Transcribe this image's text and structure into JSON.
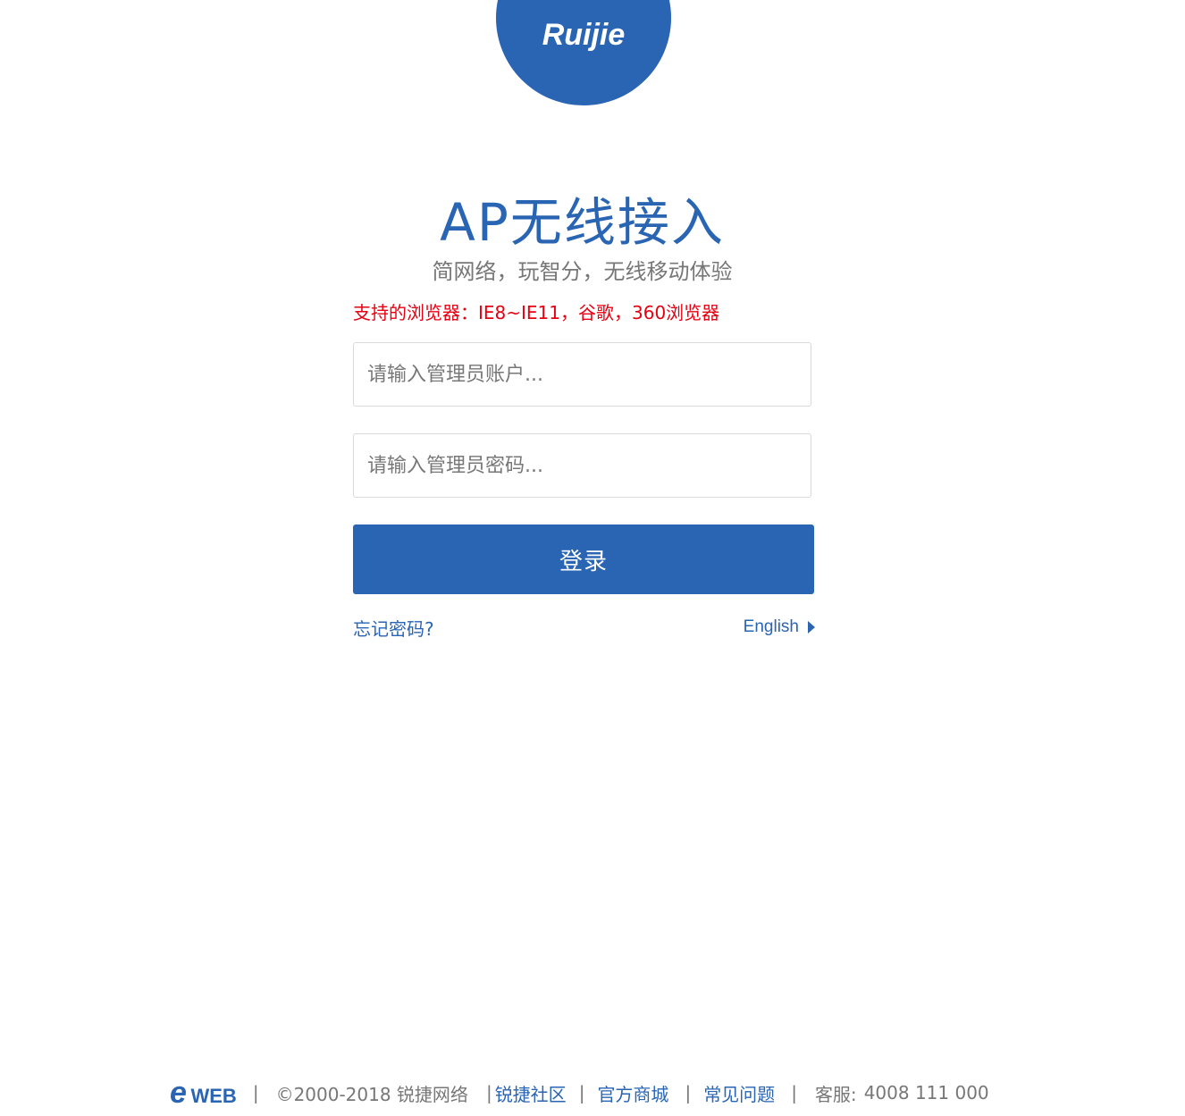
{
  "brand": {
    "logo_text": "Ruijie",
    "primary_color": "#2a65b3",
    "warning_color": "#e60012"
  },
  "header": {
    "title": "AP无线接入",
    "subtitle": "简网络，玩智分，无线移动体验"
  },
  "notice": {
    "browser_support": "支持的浏览器：IE8~IE11，谷歌，360浏览器"
  },
  "form": {
    "username_placeholder": "请输入管理员账户...",
    "username_value": "",
    "password_placeholder": "请输入管理员密码...",
    "password_value": "",
    "login_label": "登录",
    "forgot_label": "忘记密码?",
    "language_label": "English"
  },
  "footer": {
    "logo_e": "e",
    "logo_web": "WEB",
    "separator": "|",
    "copyright": "©2000-2018 锐捷网络",
    "links": [
      "锐捷社区",
      "官方商城",
      "常见问题"
    ],
    "service_label": "客服:",
    "service_phone": "4008 111 000"
  }
}
